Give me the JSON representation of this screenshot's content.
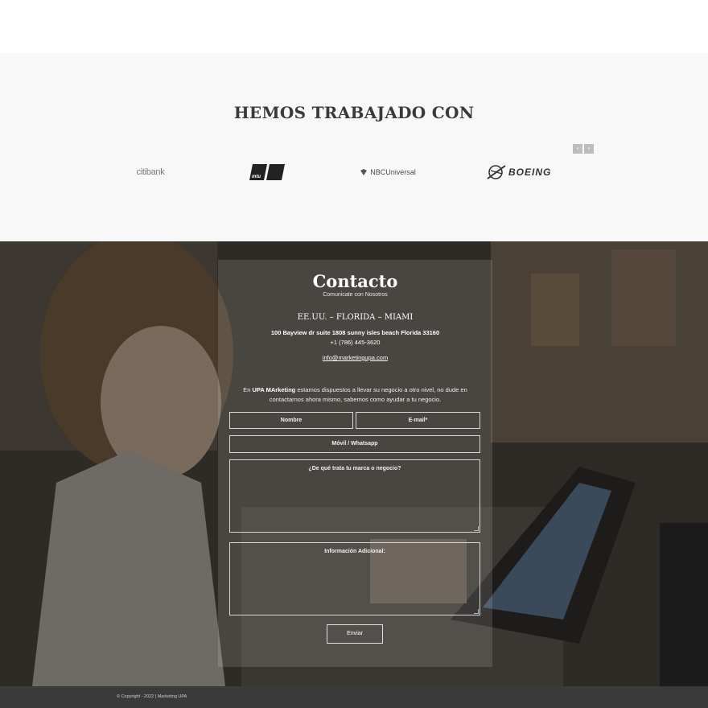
{
  "clients": {
    "title": "HEMOS TRABAJADO CON",
    "prev_arrow": "‹",
    "next_arrow": "›",
    "logos": [
      {
        "name": "citibank",
        "text": "citibank"
      },
      {
        "name": "mtu",
        "text": "mtu"
      },
      {
        "name": "nbcuniversal",
        "text": "NBCUniversal"
      },
      {
        "name": "boeing",
        "text": "BOEING"
      }
    ]
  },
  "contact": {
    "title": "Contacto",
    "subtitle": "Comunicate con Nosotros",
    "location": "EE.UU. – FLORIDA – MIAMI",
    "address": "100 Bayview dr suite 1808 sunny isles beach Florida 33160",
    "phone": "+1 (786) 445-3620",
    "email": "info@marketingupa.com",
    "intro_prefix": "En",
    "intro_brand": "UPA MArketing",
    "intro_rest": "estamos dispuestos a llevar su negocio a otro nivel, no dude en contactarnos ahora mismo, sabemos como ayudar a tu negocio.",
    "form": {
      "name_placeholder": "Nombre",
      "email_placeholder": "E-mail*",
      "phone_placeholder": "Móvil / Whatsapp",
      "brand_placeholder": "¿De qué trata tu marca o negocio?",
      "info_placeholder": "Información Adicional:",
      "submit_label": "Enviar"
    }
  },
  "footer": {
    "copyright": "© Copyright - 2022 | Marketing UPA"
  },
  "colors": {
    "section_bg": "#f8f8f8",
    "footer_bg": "#3a3a3a",
    "overlay": "#2b2925"
  }
}
